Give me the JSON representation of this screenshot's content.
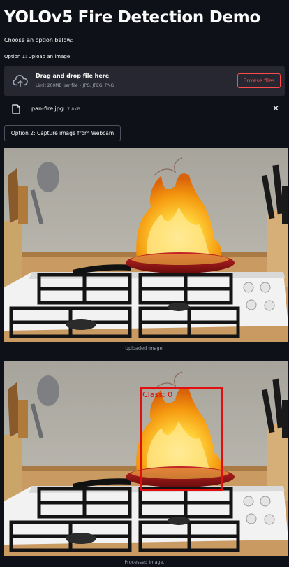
{
  "app": {
    "title": "YOLOv5 Fire Detection Demo",
    "intro": "Choose an option below:",
    "option1_label": "Option 1: Upload an image"
  },
  "uploader": {
    "drag_text": "Drag and drop file here",
    "limit_text": "Limit 200MB per file • JPG, JPEG, PNG",
    "browse_label": "Browse files",
    "icon": "cloud-upload-icon"
  },
  "file": {
    "name": "pan-fire.jpg",
    "size": "7.8KB",
    "remove_glyph": "✕"
  },
  "webcam": {
    "button_label": "Option 2: Capture image from Webcam"
  },
  "images": {
    "uploaded_caption": "Uploaded Image.",
    "processed_caption": "Processed Image."
  },
  "detection": {
    "label": "Class: 0",
    "color": "#e01010"
  },
  "colors": {
    "background": "#0e1117",
    "accent": "#ff4b4b",
    "uploader_bg": "#262730"
  }
}
